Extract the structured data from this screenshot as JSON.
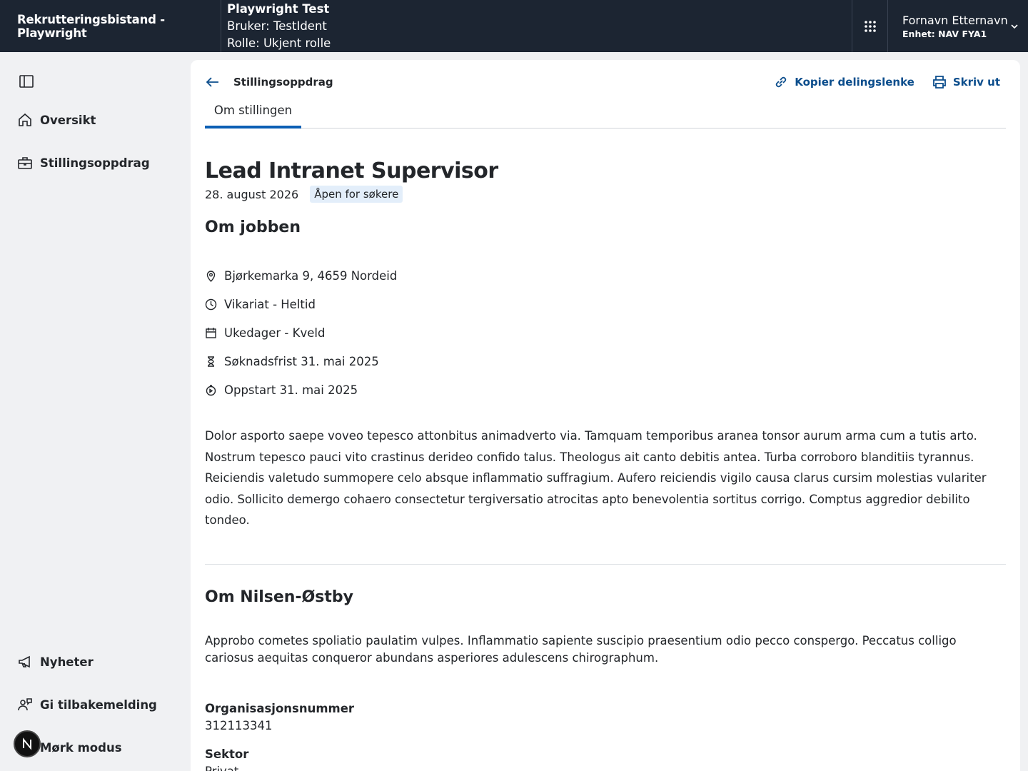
{
  "header": {
    "brand": "Rekrutteringsbistand - Playwright",
    "test_title": "Playwright Test",
    "user_line": "Bruker: TestIdent",
    "role_line": "Rolle: Ukjent rolle",
    "user_name": "Fornavn Etternavn",
    "user_unit": "Enhet: NAV FYA1"
  },
  "sidebar": {
    "items": [
      {
        "label": "Oversikt",
        "icon": "house-icon"
      },
      {
        "label": "Stillingsoppdrag",
        "icon": "briefcase-icon"
      }
    ],
    "bottom_items": [
      {
        "label": "Nyheter",
        "icon": "megaphone-icon"
      },
      {
        "label": "Gi tilbakemelding",
        "icon": "feedback-icon"
      },
      {
        "label": "Mørk modus",
        "icon": "moon-icon"
      }
    ]
  },
  "main": {
    "breadcrumb": "Stillingsoppdrag",
    "actions": {
      "copy_link": "Kopier delingslenke",
      "print": "Skriv ut"
    },
    "tab": "Om stillingen",
    "title": "Lead Intranet Supervisor",
    "date": "28. august 2026",
    "status_badge": "Åpen for søkere",
    "about_job_heading": "Om jobben",
    "facts": [
      {
        "icon": "location-pin-icon",
        "text": "Bjørkemarka 9, 4659 Nordeid"
      },
      {
        "icon": "clock-icon",
        "text": "Vikariat - Heltid"
      },
      {
        "icon": "calendar-icon",
        "text": "Ukedager - Kveld"
      },
      {
        "icon": "hourglass-icon",
        "text": "Søknadsfrist 31. mai 2025"
      },
      {
        "icon": "stopwatch-icon",
        "text": "Oppstart 31. mai 2025"
      }
    ],
    "description": "Dolor asporto saepe voveo tepesco attonbitus animadverto via. Tamquam temporibus aranea tonsor aurum arma cum a tutis arto. Nostrum tepesco pauci vito crastinus derideo confido talus. Theologus ait canto debitis antea. Turba corroboro blanditiis tyrannus. Reiciendis valetudo summopere celo absque inflammatio suffragium. Aufero reiciendis vigilo causa clarus cursim molestias vulariter odio. Sollicito demergo cohaero consectetur tergiversatio atrocitas apto benevolentia sortitus corrigo. Comptus aggredior debilito tondeo.",
    "employer_heading": "Om Nilsen-Østby",
    "employer_description": "Approbo cometes spoliatio paulatim vulpes. Inflammatio sapiente suscipio praesentium odio pecco conspergo. Peccatus colligo cariosus aequitas conqueror abundans asperiores adulescens chirographum.",
    "org_label": "Organisasjonsnummer",
    "org_value": "312113341",
    "sector_label": "Sektor",
    "sector_value": "Privat"
  },
  "colors": {
    "header_bg": "#1c2532",
    "accent": "#0b5fb4",
    "link": "#0b4d8c",
    "badge_bg": "#e3eefa"
  }
}
